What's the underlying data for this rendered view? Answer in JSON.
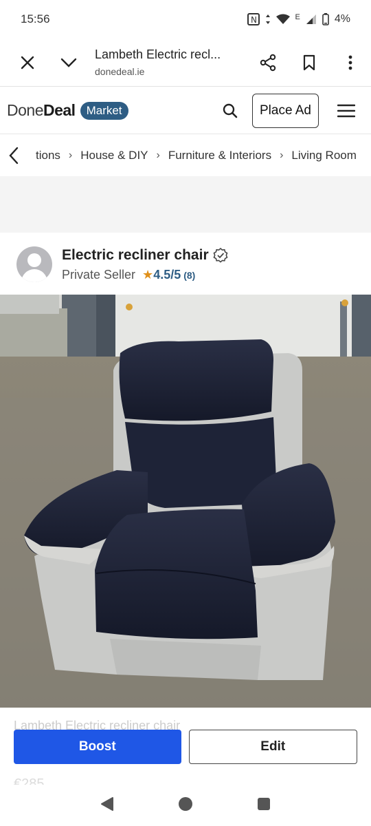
{
  "status_bar": {
    "time": "15:56",
    "battery": "4%",
    "network": "E"
  },
  "browser": {
    "page_title": "Lambeth Electric recl...",
    "domain": "donedeal.ie"
  },
  "site_header": {
    "logo_done": "Done",
    "logo_deal": "Deal",
    "market_badge": "Market",
    "place_ad_label": "Place Ad"
  },
  "breadcrumb": {
    "items": [
      "tions",
      "House & DIY",
      "Furniture & Interiors",
      "Living Room"
    ]
  },
  "listing": {
    "title": "Electric recliner chair",
    "seller_type": "Private Seller",
    "rating": "4.5/5",
    "rating_count": "(8)",
    "description_peek": "Lambeth Electric recliner chair",
    "price_peek": "€285"
  },
  "actions": {
    "boost_label": "Boost",
    "edit_label": "Edit"
  },
  "colors": {
    "brand_blue": "#2e5d84",
    "boost_blue": "#1f57e6",
    "star": "#e0901a"
  }
}
